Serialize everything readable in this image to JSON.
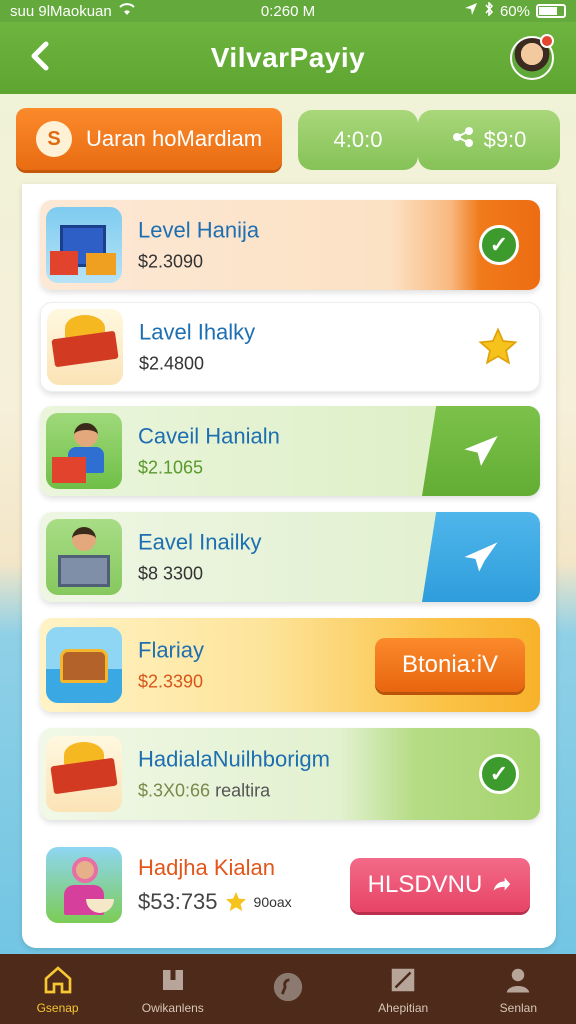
{
  "status_bar": {
    "carrier": "suu 9lMaokuan",
    "time": "0:260 M",
    "battery": "60%"
  },
  "header": {
    "title": "VilvarPayiy",
    "back_label": "<"
  },
  "chips": {
    "main_icon": "S",
    "main_label": "Uaran hoMardiam",
    "time_value": "4:0:0",
    "share_value": "$9:0"
  },
  "rows": [
    {
      "title": "Level Hanija",
      "value": "$2.3090",
      "action": "check",
      "thumb": "building-icon"
    },
    {
      "title": "Lavel Ihalky",
      "value": "$2.4800",
      "action": "star",
      "thumb": "badge-icon"
    },
    {
      "title": "Caveil Hanialn",
      "value": "$2.1065",
      "action": "plane",
      "thumb": "kid-icon"
    },
    {
      "title": "Eavel Inailky",
      "value": "$8 3300",
      "action": "plane",
      "thumb": "kid-box-icon"
    },
    {
      "title": "Flariay",
      "value": "$2.3390",
      "action_label": "Btonia:iV",
      "thumb": "beach-chest-icon"
    },
    {
      "title": "HadialaNuilhborigm",
      "value": "$.3X0:66",
      "note": "realtira",
      "action": "check",
      "thumb": "badge-icon"
    },
    {
      "title": "Hadjha Kialan",
      "value": "$53:735",
      "note": "90oax",
      "action_label": "HLSDVNU",
      "thumb": "girl-icon"
    }
  ],
  "colors": {
    "header_green": "#6db53f",
    "orange": "#f57a1e",
    "light_green": "#c9e6a3",
    "blue": "#3aa9e3",
    "pink": "#ee4f74"
  },
  "bottom_nav": {
    "items": [
      {
        "label": "Gsenap",
        "icon": "home-icon"
      },
      {
        "label": "Owikanlens",
        "icon": "building-icon"
      },
      {
        "label": "",
        "icon": "search-icon"
      },
      {
        "label": "Ahepitian",
        "icon": "image-icon"
      },
      {
        "label": "Senlan",
        "icon": "profile-icon"
      }
    ]
  }
}
